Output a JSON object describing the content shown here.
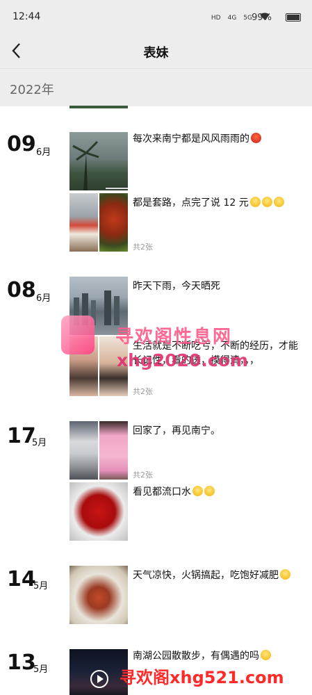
{
  "status": {
    "time": "12:44",
    "network": [
      "HD",
      "4G",
      "5G"
    ],
    "battery": "99%"
  },
  "header": {
    "title": "表妹",
    "back_icon": "chevron-left-icon"
  },
  "year": "2022年",
  "entries": [
    {
      "day": "09",
      "month": "6月",
      "posts": [
        {
          "text": "每次来南宁都是风风雨雨的",
          "emoji": "angry-face-icon"
        },
        {
          "text": "都是套路，点完了说 12 元",
          "emoji": "grin-face-icons",
          "count": "共2张"
        }
      ]
    },
    {
      "day": "08",
      "month": "6月",
      "posts": [
        {
          "text": "昨天下雨，今天晒死"
        },
        {
          "text": "生活就是不断吃亏，不断的经历，才能长记性，看的透，摸得清，，，",
          "count": "共2张"
        }
      ]
    },
    {
      "day": "17",
      "month": "5月",
      "posts": [
        {
          "text": "回家了，再见南宁。",
          "count": "共2张"
        },
        {
          "text": "看见都流口水",
          "emoji": "grin-face-icons"
        }
      ]
    },
    {
      "day": "14",
      "month": "5月",
      "posts": [
        {
          "text": "天气凉快，火锅搞起，吃饱好减肥",
          "emoji": "relieved-face-icon"
        }
      ]
    },
    {
      "day": "13",
      "month": "5月",
      "posts": [
        {
          "text": "南湖公园散散步，有偶遇的吗",
          "emoji": "smile-face-icon"
        }
      ]
    }
  ],
  "watermarks": {
    "mid_title": "寻欢阁性息网",
    "mid_url": "xhg2020.com",
    "bottom": "寻欢阁xhg521.com"
  }
}
